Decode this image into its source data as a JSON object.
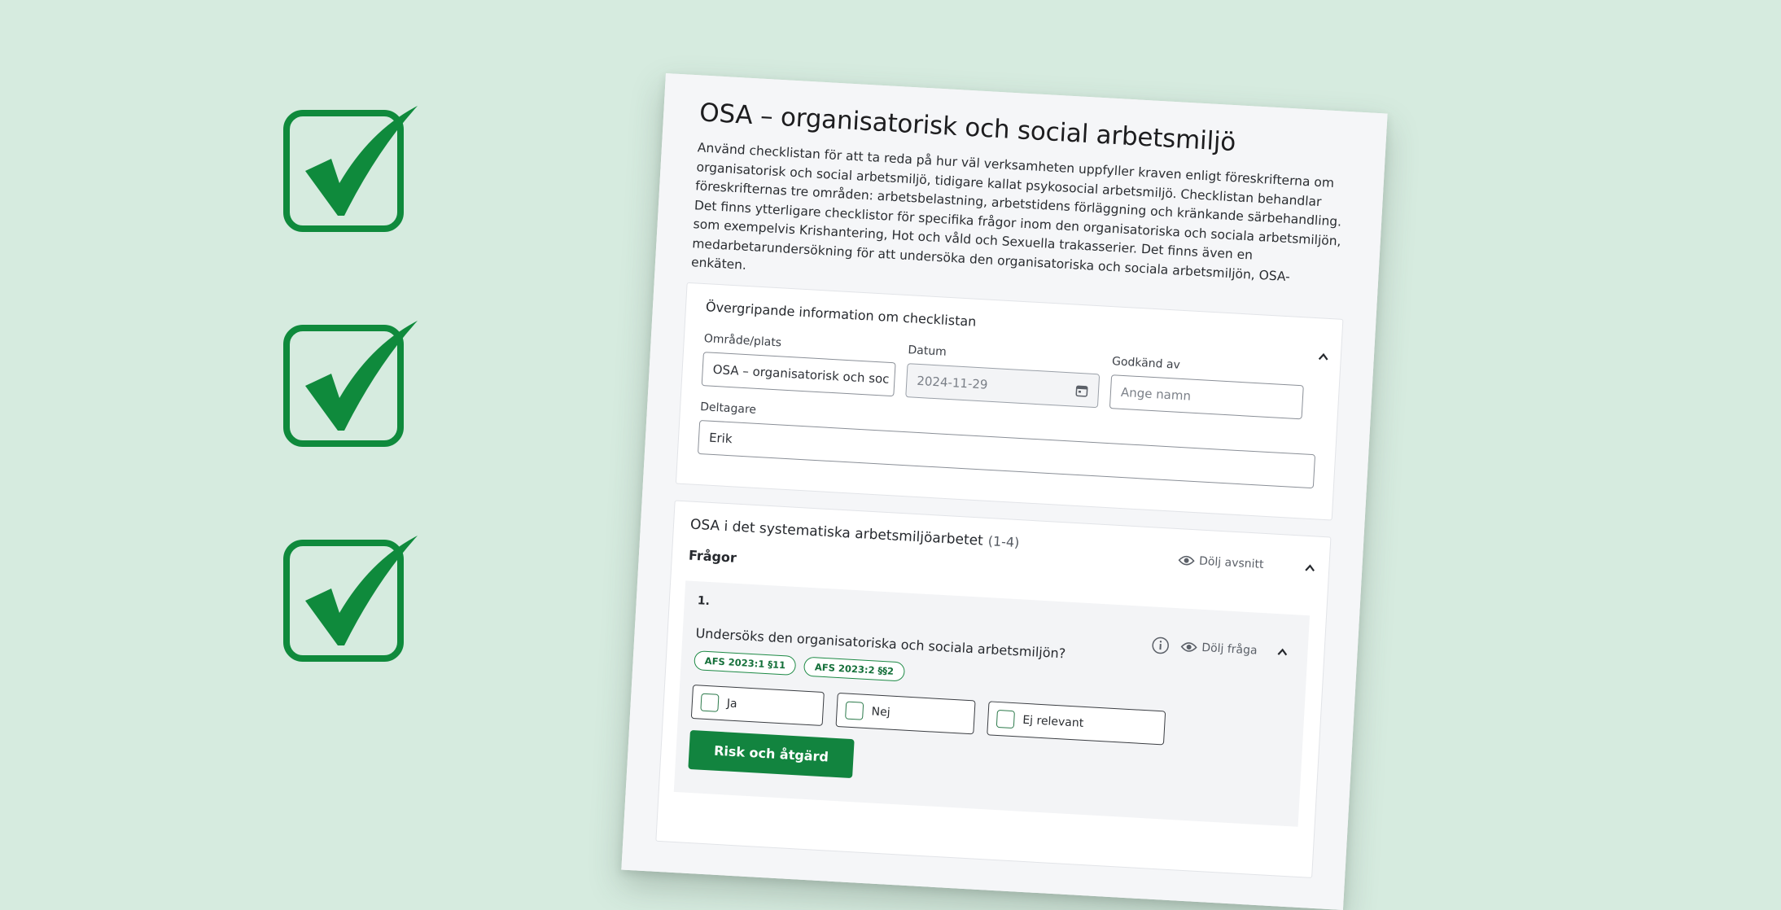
{
  "colors": {
    "background": "#d6ebdf",
    "brand_green": "#12843f",
    "check_green": "#0f8a3c"
  },
  "checkmarks": [
    {
      "icon": "checkbox-checked-icon"
    },
    {
      "icon": "checkbox-checked-icon"
    },
    {
      "icon": "checkbox-checked-icon"
    }
  ],
  "document": {
    "title": "OSA – organisatorisk och social arbetsmiljö",
    "intro": "Använd checklistan för att ta reda på hur väl verksamheten uppfyller kraven enligt föreskrifterna om organisatorisk och social arbetsmiljö, tidigare kallat psykosocial arbetsmiljö. Checklistan behandlar föreskrifternas tre områden: arbetsbelastning, arbetstidens förläggning och kränkande särbehandling. Det finns ytterligare checklistor för specifika frågor inom den organisatoriska och sociala arbetsmiljön, som exempelvis Krishantering, Hot och våld och Sexuella trakasserier. Det finns även en medarbetarundersökning för att undersöka den organisatoriska och sociala arbetsmiljön, OSA-enkäten.",
    "overview": {
      "title": "Övergripande information om checklistan",
      "area_label": "Område/plats",
      "area_value": "OSA – organisatorisk och soc",
      "date_label": "Datum",
      "date_value": "2024-11-29",
      "approved_label": "Godkänd av",
      "approved_placeholder": "Ange namn",
      "participants_label": "Deltagare",
      "participants_value": "Erik"
    },
    "section": {
      "title": "OSA i det systematiska arbetsmiljöarbetet",
      "range": "(1-4)",
      "hide_section": "Dölj avsnitt",
      "questions_heading": "Frågor",
      "question": {
        "number": "1.",
        "text": "Undersöks den organisatoriska och sociala arbetsmiljön?",
        "hide_question": "Dölj fråga",
        "tags": [
          "AFS 2023:1 §11",
          "AFS 2023:2 §§2"
        ],
        "answers": [
          "Ja",
          "Nej",
          "Ej relevant"
        ],
        "risk_button": "Risk och åtgärd"
      }
    }
  }
}
